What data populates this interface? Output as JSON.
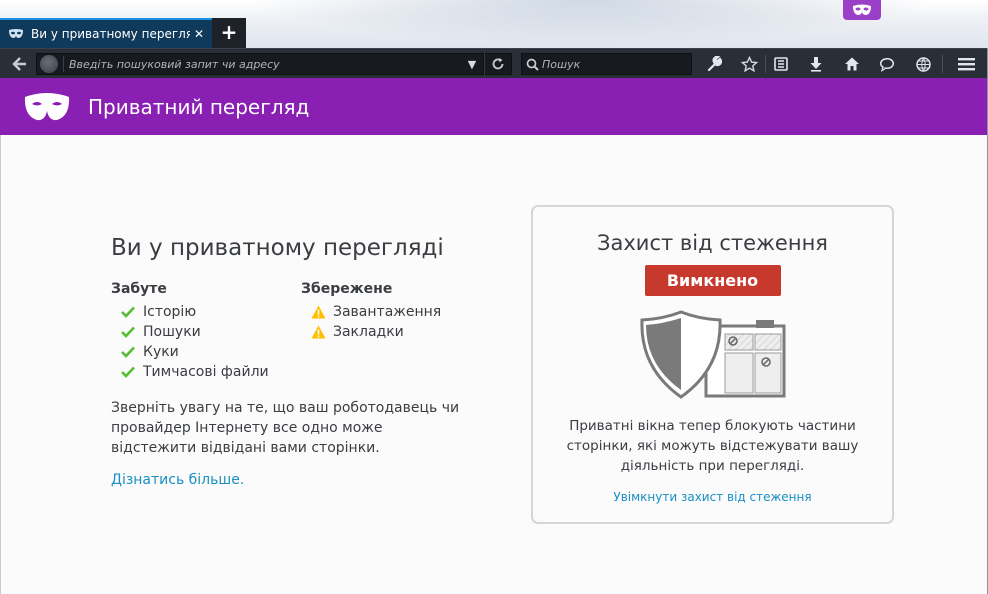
{
  "browser": {
    "tab": {
      "title": "Ви у приватному перегляді",
      "close_glyph": "✕",
      "icon": "private-mask-icon"
    },
    "new_tab_label": "+",
    "urlbar": {
      "placeholder": "Введіть пошуковий запит чи адресу",
      "value": ""
    },
    "searchbar": {
      "placeholder": "Пошук",
      "value": ""
    },
    "toolbar_icons": [
      "back-icon",
      "reload-icon",
      "search-icon",
      "wrench-icon",
      "star-icon",
      "reading-list-icon",
      "download-icon",
      "home-icon",
      "chat-icon",
      "globe-icon",
      "menu-icon"
    ]
  },
  "header": {
    "title": "Приватний перегляд"
  },
  "main": {
    "heading": "Ви у приватному перегляді",
    "forgotten": {
      "title": "Забуте",
      "items": [
        "Історію",
        "Пошуки",
        "Куки",
        "Тимчасові файли"
      ]
    },
    "saved": {
      "title": "Збережене",
      "items": [
        "Завантаження",
        "Закладки"
      ]
    },
    "notice": "Зверніть увагу на те, що ваш роботодавець чи провайдер Інтернету все одно може відстежити відвідані вами сторінки.",
    "learn_more": "Дізнатись більше."
  },
  "tracking_protection": {
    "title": "Захист від стеження",
    "status": "Вимкнено",
    "description": "Приватні вікна тепер блокують частини сторінки, які можуть відстежувати вашу діяльність при перегляді.",
    "enable_link": "Увімкнути захист від стеження"
  },
  "colors": {
    "private_purple": "#8a1fb4",
    "status_red": "#c7382d",
    "link_blue": "#1b8fc5",
    "check_green": "#57bd35",
    "warning_yellow": "#ffbf00",
    "tab_active": "#0f3a5c",
    "toolbar_dark": "#2a2e36"
  }
}
